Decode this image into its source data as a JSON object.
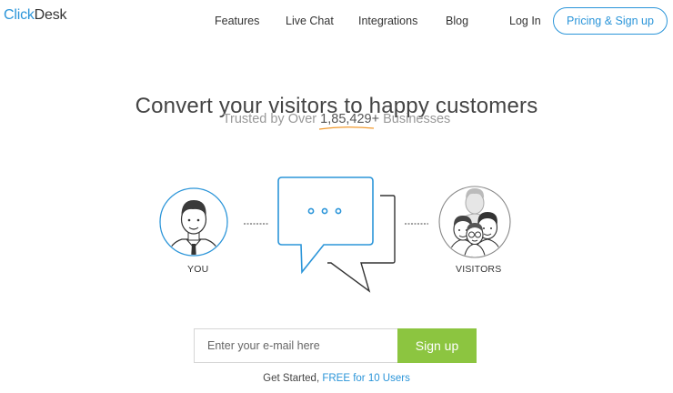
{
  "brand": {
    "logo_part1": "Click",
    "logo_part2": "Desk",
    "accent": "#2b95d9",
    "cta_green": "#8cc540"
  },
  "nav": {
    "items": [
      "Features",
      "Live Chat",
      "Integrations",
      "Blog"
    ],
    "login": "Log In",
    "cta": "Pricing & Sign up"
  },
  "hero": {
    "headline": "Convert your visitors to happy customers",
    "trusted_prefix": "Trusted by Over ",
    "trusted_count": "1,85,429+",
    "trusted_suffix": " Businesses",
    "you_label": "YOU",
    "visitors_label": "VISITORS",
    "icons": [
      "agent-avatar-icon",
      "chat-bubble-icon",
      "visitors-group-icon"
    ]
  },
  "signup": {
    "email_placeholder": "Enter your e-mail here",
    "button": "Sign up",
    "note_prefix": "Get Started, ",
    "note_free": "FREE for 10 Users"
  }
}
